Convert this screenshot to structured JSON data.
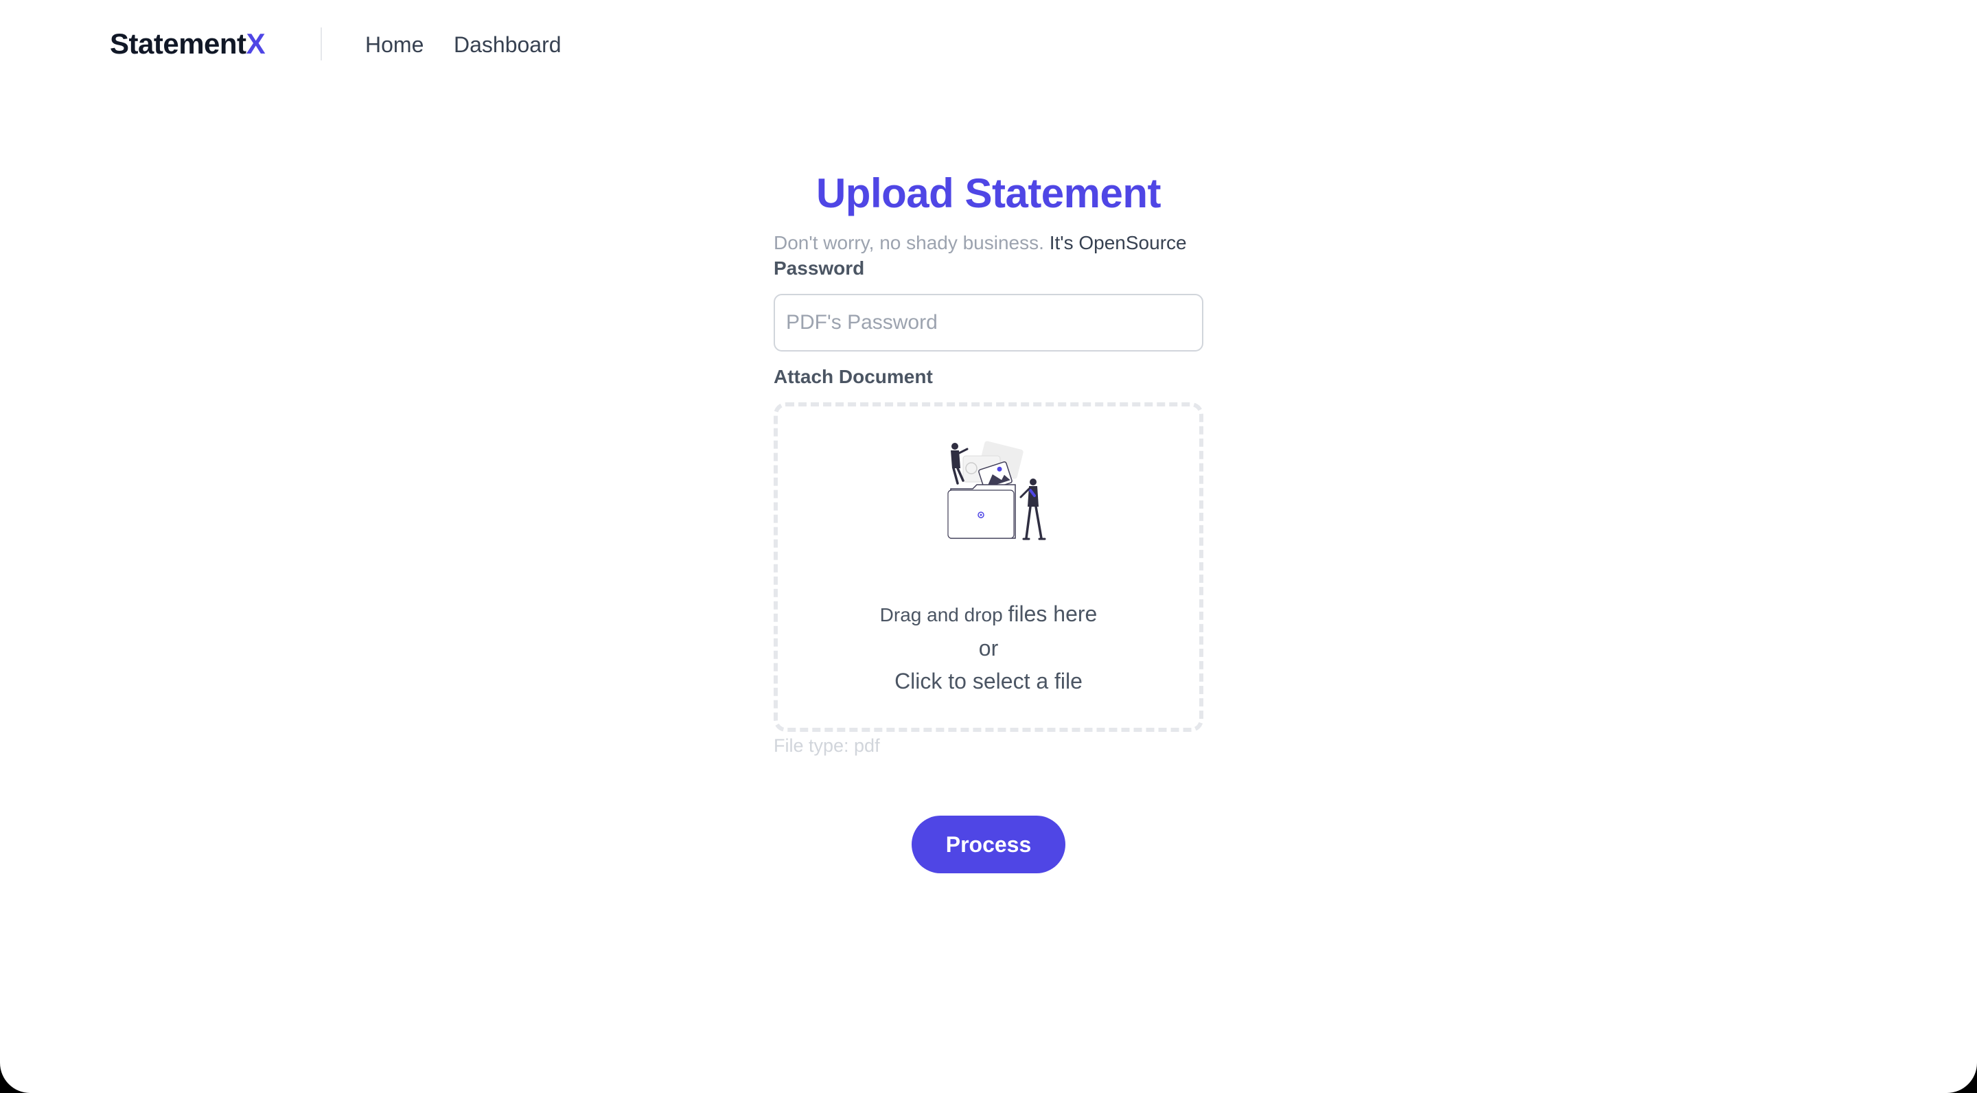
{
  "header": {
    "brand_main": "Statement",
    "brand_accent": "X",
    "nav": {
      "home": "Home",
      "dashboard": "Dashboard"
    }
  },
  "form": {
    "title": "Upload Statement",
    "subtitle_muted": "Don't worry, no shady business.",
    "subtitle_link": "It's OpenSource",
    "password_label": "Password",
    "password_placeholder": "PDF's Password",
    "password_value": "",
    "attach_label": "Attach Document",
    "dropzone": {
      "line1_small": "Drag and drop",
      "line1_big": "files here",
      "line2": "or",
      "line3": "Click to select a file",
      "illustration": "upload-people-illustration"
    },
    "file_type_hint": "File type: pdf",
    "submit_label": "Process"
  },
  "colors": {
    "accent": "#4f46e5",
    "text_dark": "#111827",
    "text_muted": "#9ca3af",
    "border": "#d1d5db",
    "dropzone_border": "#e5e7eb"
  }
}
